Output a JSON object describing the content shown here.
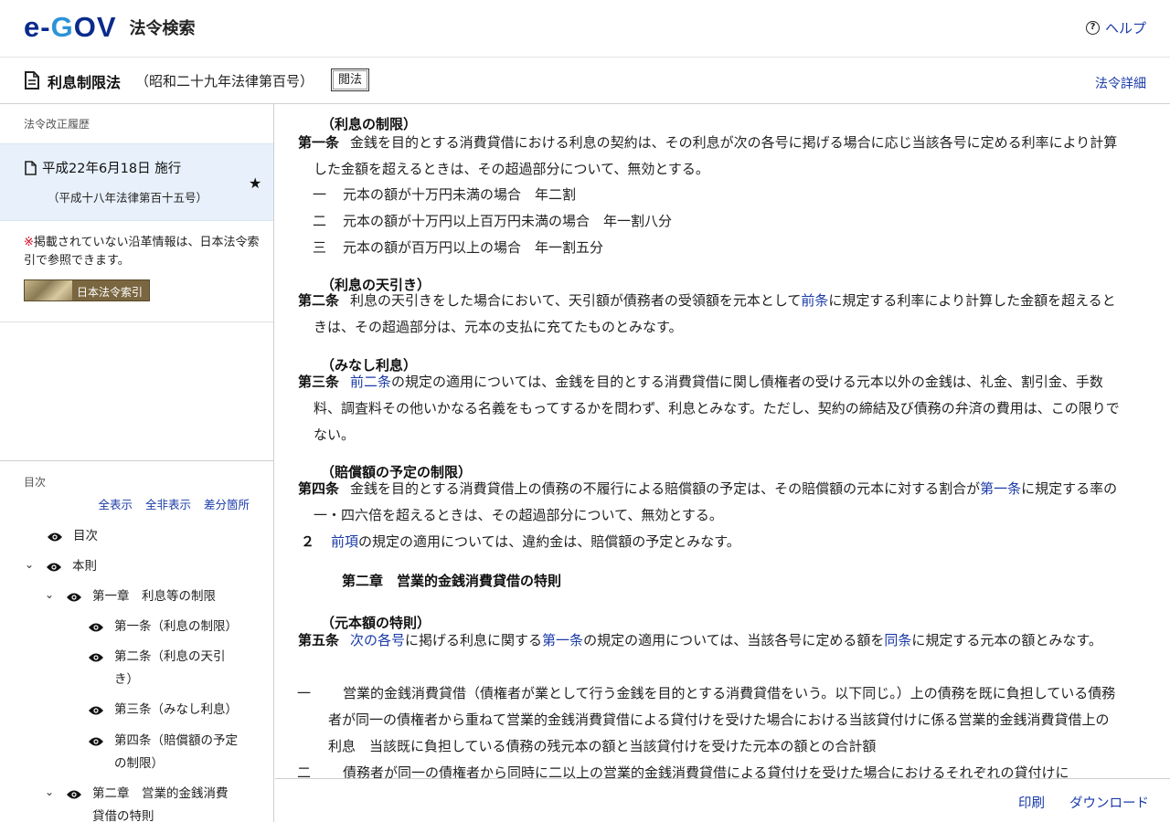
{
  "header": {
    "logo_e": "e",
    "logo_dash": "-",
    "logo_g": "G",
    "logo_ov": "OV",
    "site_name": "法令検索",
    "help_label": "ヘルプ"
  },
  "law": {
    "title": "利息制限法",
    "number": "（昭和二十九年法律第百号）",
    "badge": "閲法",
    "detail_link": "法令詳細"
  },
  "sidebar": {
    "history_heading": "法令改正履歴",
    "revision": {
      "date": "平成22年6月18日 施行",
      "law": "（平成十八年法律第百十五号）"
    },
    "note_mark": "※",
    "note_text": "掲載されていない沿革情報は、日本法令索引で参照できます。",
    "index_label": "日本法令索引",
    "toc_heading": "目次",
    "toc_actions": [
      "全表示",
      "全非表示",
      "差分箇所"
    ],
    "toc": [
      {
        "label": "目次"
      },
      {
        "label": "本則"
      },
      {
        "label": "第一章　利息等の制限"
      },
      {
        "label": "第一条（利息の制限）"
      },
      {
        "label": "第二条（利息の天引き）"
      },
      {
        "label": "第三条（みなし利息）"
      },
      {
        "label": "第四条（賠償額の予定の制限）"
      },
      {
        "label": "第二章　営業的金銭消費貸借の特則"
      }
    ]
  },
  "content": {
    "a1": {
      "caption": "（利息の制限）",
      "num": "第一条",
      "text": "金銭を目的とする消費貸借における利息の契約は、その利息が次の各号に掲げる場合に応じ当該各号に定める利率により計算した金額を超えるときは、その超過部分について、無効とする。",
      "items": [
        {
          "num": "一",
          "text": "元本の額が十万円未満の場合　年二割"
        },
        {
          "num": "二",
          "text": "元本の額が十万円以上百万円未満の場合　年一割八分"
        },
        {
          "num": "三",
          "text": "元本の額が百万円以上の場合　年一割五分"
        }
      ]
    },
    "a2": {
      "caption": "（利息の天引き）",
      "num": "第二条",
      "text_1": "利息の天引きをした場合において、天引額が債務者の受領額を元本として",
      "link_1": "前条",
      "text_2": "に規定する利率により計算した金額を超えるときは、その超過部分は、元本の支払に充てたものとみなす。"
    },
    "a3": {
      "caption": "（みなし利息）",
      "num": "第三条",
      "link_1": "前二条",
      "text_1": "の規定の適用については、金銭を目的とする消費貸借に関し債権者の受ける元本以外の金銭は、礼金、割引金、手数料、調査料その他いかなる名義をもってするかを問わず、利息とみなす。ただし、契約の締結及び債務の弁済の費用は、この限りでない。"
    },
    "a4": {
      "caption": "（賠償額の予定の制限）",
      "num": "第四条",
      "text_1": "金銭を目的とする消費貸借上の債務の不履行による賠償額の予定は、その賠償額の元本に対する割合が",
      "link_1": "第一条",
      "text_2": "に規定する率の一・四六倍を超えるときは、その超過部分について、無効とする。",
      "p2_num": "２",
      "p2_link": "前項",
      "p2_text": "の規定の適用については、違約金は、賠償額の予定とみなす。"
    },
    "chapter2": "第二章　営業的金銭消費貸借の特則",
    "a5": {
      "caption": "（元本額の特則）",
      "num": "第五条",
      "link_1": "次の各号",
      "text_1": "に掲げる利息に関する",
      "link_2": "第一条",
      "text_2": "の規定の適用については、当該各号に定める額を",
      "link_3": "同条",
      "text_3": "に規定する元本の額とみなす。",
      "items": [
        {
          "num": "一",
          "text": "営業的金銭消費貸借（債権者が業として行う金銭を目的とする消費貸借をいう。以下同じ。）上の債務を既に負担している債務者が同一の債権者から重ねて営業的金銭消費貸借による貸付けを受けた場合における当該貸付けに係る営業的金銭消費貸借上の利息　当該既に負担している債務の残元本の額と当該貸付けを受けた元本の額との合計額"
        },
        {
          "num": "二",
          "text": "債務者が同一の債権者から同時に二以上の営業的金銭消費貸借による貸付けを受けた場合におけるそれぞれの貸付けに"
        }
      ]
    }
  },
  "footer": {
    "print_label": "印刷",
    "download_label": "ダウンロード"
  }
}
